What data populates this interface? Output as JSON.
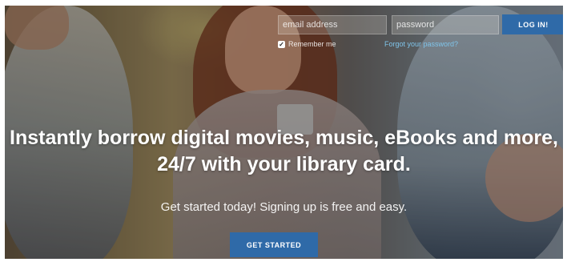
{
  "login": {
    "email_placeholder": "email address",
    "password_placeholder": "password",
    "login_label": "LOG IN!",
    "remember_label": "Remember me",
    "remember_checked": true,
    "forgot_label": "Forgot your password?"
  },
  "hero": {
    "headline_line1": "Instantly borrow digital movies, music, eBooks and more,",
    "headline_line2": "24/7 with your library card.",
    "subheadline": "Get started today! Signing up is free and easy.",
    "cta_label": "GET STARTED"
  },
  "colors": {
    "button_blue": "#2f6aa8",
    "link_blue": "#7fc4ea"
  }
}
